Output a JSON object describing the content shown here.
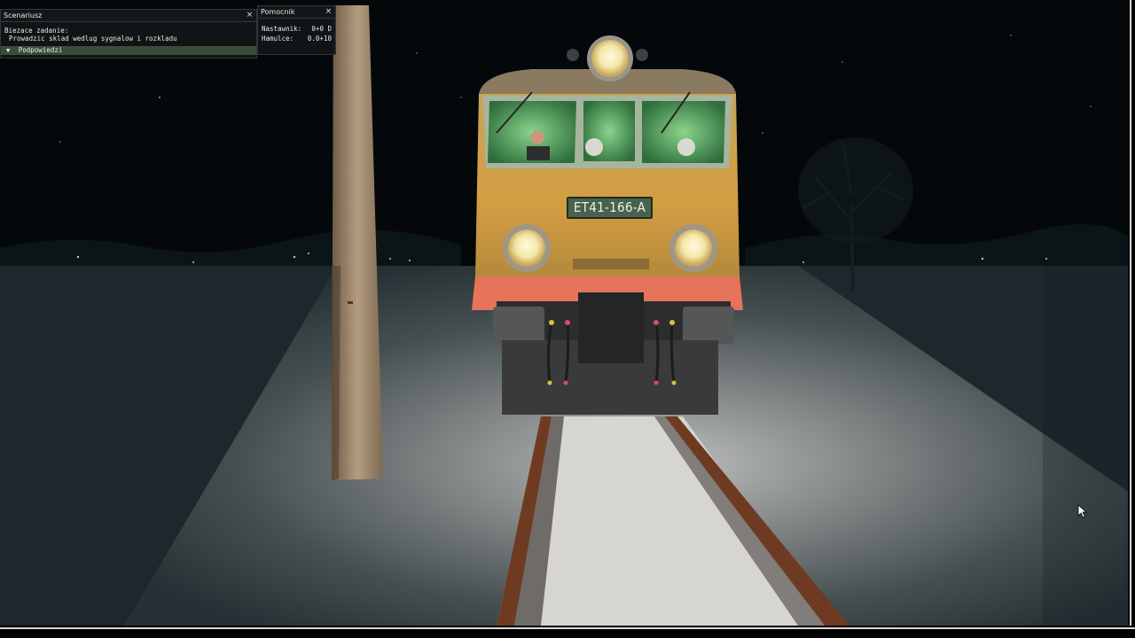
{
  "scenario_window": {
    "title": "Scenariusz",
    "close": "×",
    "task_label": "Biezace zadanie:",
    "task_text": "Prowadzic sklad wedlug sygnalow i rozkladu",
    "hints_toggle": "▼",
    "hints_label": "Podpowiedzi"
  },
  "helper_window": {
    "title": "Pomocnik",
    "close": "×",
    "rows": [
      {
        "label": "Nastawnik:",
        "value": "0+0 D"
      },
      {
        "label": "Hamulce:",
        "value": "0.0+10"
      }
    ]
  },
  "locomotive": {
    "number": "ET41-166-A",
    "colors": {
      "body": "#c99a3e",
      "front": "#e5745a",
      "window_glow": "#3fa55a",
      "plate": "#49624c"
    }
  },
  "scene": {
    "time_of_day": "night",
    "season": "winter"
  }
}
